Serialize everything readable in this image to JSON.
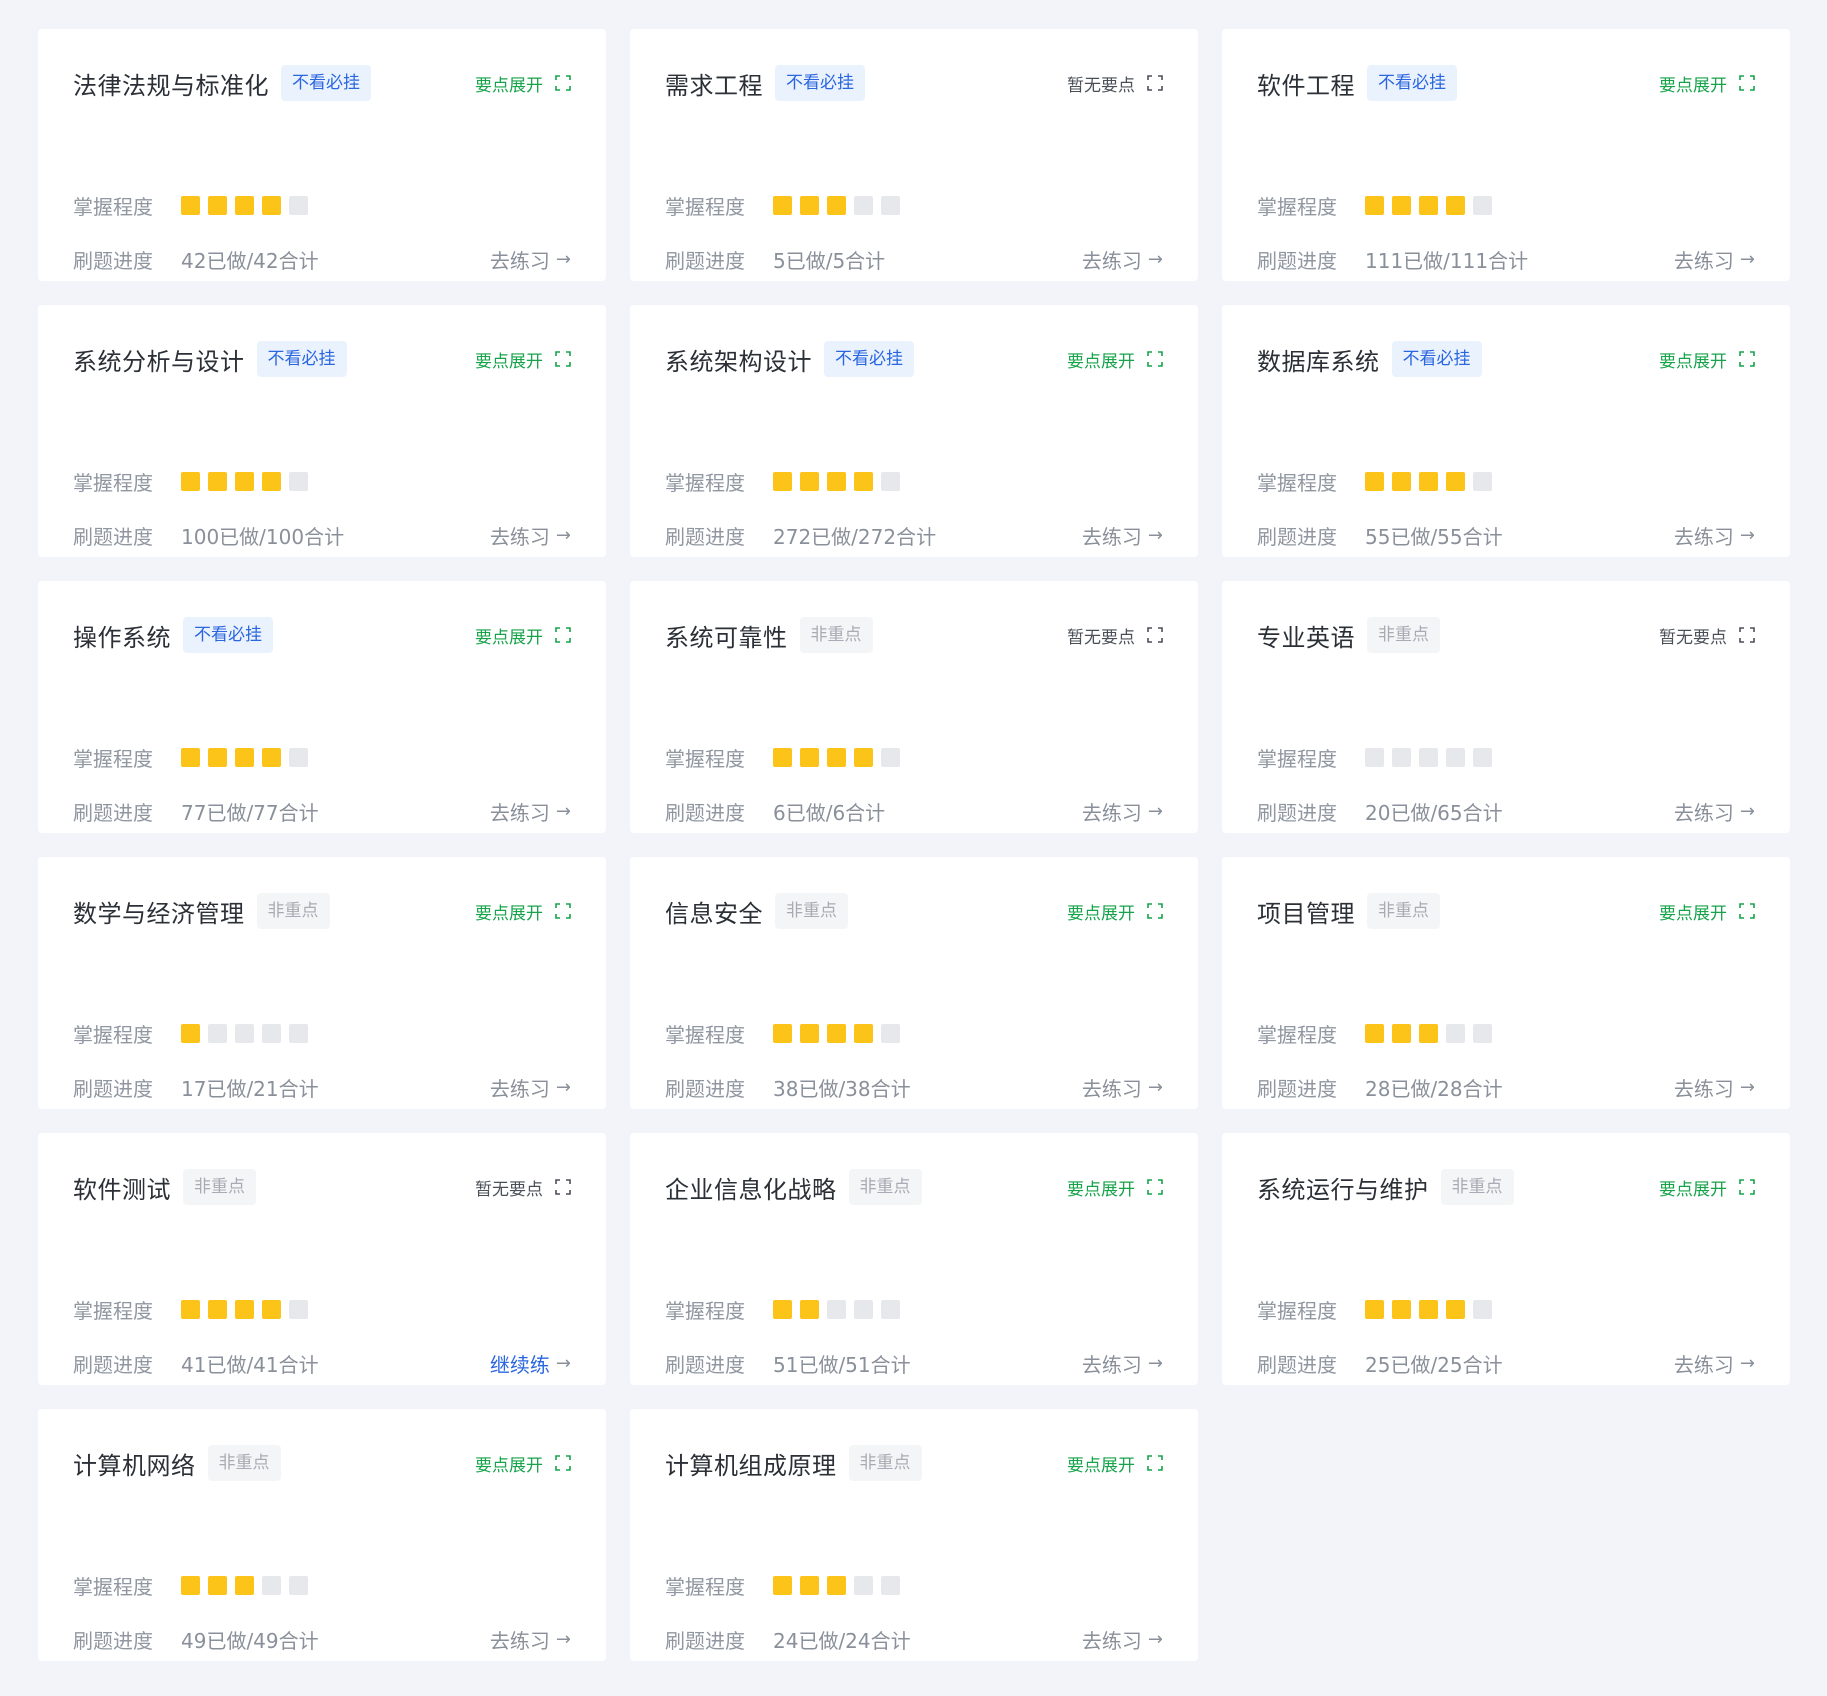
{
  "labels": {
    "mastery": "掌握程度",
    "progress": "刷题进度"
  },
  "colors": {
    "background": "#f3f4fa",
    "card": "#ffffff",
    "square_on": "#fcc419",
    "square_off": "#e7e8eb",
    "tag_blue_text": "#2a66e0",
    "tag_blue_bg": "#eaf2fe",
    "tag_gray_text": "#a7abb3",
    "expand_green": "#16a34a"
  },
  "icons": {
    "expand": "expand-corners-icon",
    "arrow": "arrow-right-icon"
  },
  "cards": [
    {
      "title": "法律法规与标准化",
      "tag": "不看必挂",
      "tag_style": "blue",
      "expand": "要点展开",
      "expand_style": "green",
      "mastery": 4,
      "progress": "42已做/42合计",
      "action": "去练习",
      "action_style": "gray"
    },
    {
      "title": "需求工程",
      "tag": "不看必挂",
      "tag_style": "blue",
      "expand": "暂无要点",
      "expand_style": "dark",
      "mastery": 3,
      "progress": "5已做/5合计",
      "action": "去练习",
      "action_style": "gray"
    },
    {
      "title": "软件工程",
      "tag": "不看必挂",
      "tag_style": "blue",
      "expand": "要点展开",
      "expand_style": "green",
      "mastery": 4,
      "progress": "111已做/111合计",
      "action": "去练习",
      "action_style": "gray"
    },
    {
      "title": "系统分析与设计",
      "tag": "不看必挂",
      "tag_style": "blue",
      "expand": "要点展开",
      "expand_style": "green",
      "mastery": 4,
      "progress": "100已做/100合计",
      "action": "去练习",
      "action_style": "gray"
    },
    {
      "title": "系统架构设计",
      "tag": "不看必挂",
      "tag_style": "blue",
      "expand": "要点展开",
      "expand_style": "green",
      "mastery": 4,
      "progress": "272已做/272合计",
      "action": "去练习",
      "action_style": "gray"
    },
    {
      "title": "数据库系统",
      "tag": "不看必挂",
      "tag_style": "blue",
      "expand": "要点展开",
      "expand_style": "green",
      "mastery": 4,
      "progress": "55已做/55合计",
      "action": "去练习",
      "action_style": "gray"
    },
    {
      "title": "操作系统",
      "tag": "不看必挂",
      "tag_style": "blue",
      "expand": "要点展开",
      "expand_style": "green",
      "mastery": 4,
      "progress": "77已做/77合计",
      "action": "去练习",
      "action_style": "gray"
    },
    {
      "title": "系统可靠性",
      "tag": "非重点",
      "tag_style": "gray",
      "expand": "暂无要点",
      "expand_style": "dark",
      "mastery": 4,
      "progress": "6已做/6合计",
      "action": "去练习",
      "action_style": "gray"
    },
    {
      "title": "专业英语",
      "tag": "非重点",
      "tag_style": "gray",
      "expand": "暂无要点",
      "expand_style": "dark",
      "mastery": 0,
      "progress": "20已做/65合计",
      "action": "去练习",
      "action_style": "gray"
    },
    {
      "title": "数学与经济管理",
      "tag": "非重点",
      "tag_style": "gray",
      "expand": "要点展开",
      "expand_style": "green",
      "mastery": 1,
      "progress": "17已做/21合计",
      "action": "去练习",
      "action_style": "gray"
    },
    {
      "title": "信息安全",
      "tag": "非重点",
      "tag_style": "gray",
      "expand": "要点展开",
      "expand_style": "green",
      "mastery": 4,
      "progress": "38已做/38合计",
      "action": "去练习",
      "action_style": "gray"
    },
    {
      "title": "项目管理",
      "tag": "非重点",
      "tag_style": "gray",
      "expand": "要点展开",
      "expand_style": "green",
      "mastery": 3,
      "progress": "28已做/28合计",
      "action": "去练习",
      "action_style": "gray"
    },
    {
      "title": "软件测试",
      "tag": "非重点",
      "tag_style": "gray",
      "expand": "暂无要点",
      "expand_style": "dark",
      "mastery": 4,
      "progress": "41已做/41合计",
      "action": "继续练",
      "action_style": "blue"
    },
    {
      "title": "企业信息化战略",
      "tag": "非重点",
      "tag_style": "gray",
      "expand": "要点展开",
      "expand_style": "green",
      "mastery": 2,
      "progress": "51已做/51合计",
      "action": "去练习",
      "action_style": "gray"
    },
    {
      "title": "系统运行与维护",
      "tag": "非重点",
      "tag_style": "gray",
      "expand": "要点展开",
      "expand_style": "green",
      "mastery": 4,
      "progress": "25已做/25合计",
      "action": "去练习",
      "action_style": "gray"
    },
    {
      "title": "计算机网络",
      "tag": "非重点",
      "tag_style": "gray",
      "expand": "要点展开",
      "expand_style": "green",
      "mastery": 3,
      "progress": "49已做/49合计",
      "action": "去练习",
      "action_style": "gray"
    },
    {
      "title": "计算机组成原理",
      "tag": "非重点",
      "tag_style": "gray",
      "expand": "要点展开",
      "expand_style": "green",
      "mastery": 3,
      "progress": "24已做/24合计",
      "action": "去练习",
      "action_style": "gray"
    }
  ]
}
